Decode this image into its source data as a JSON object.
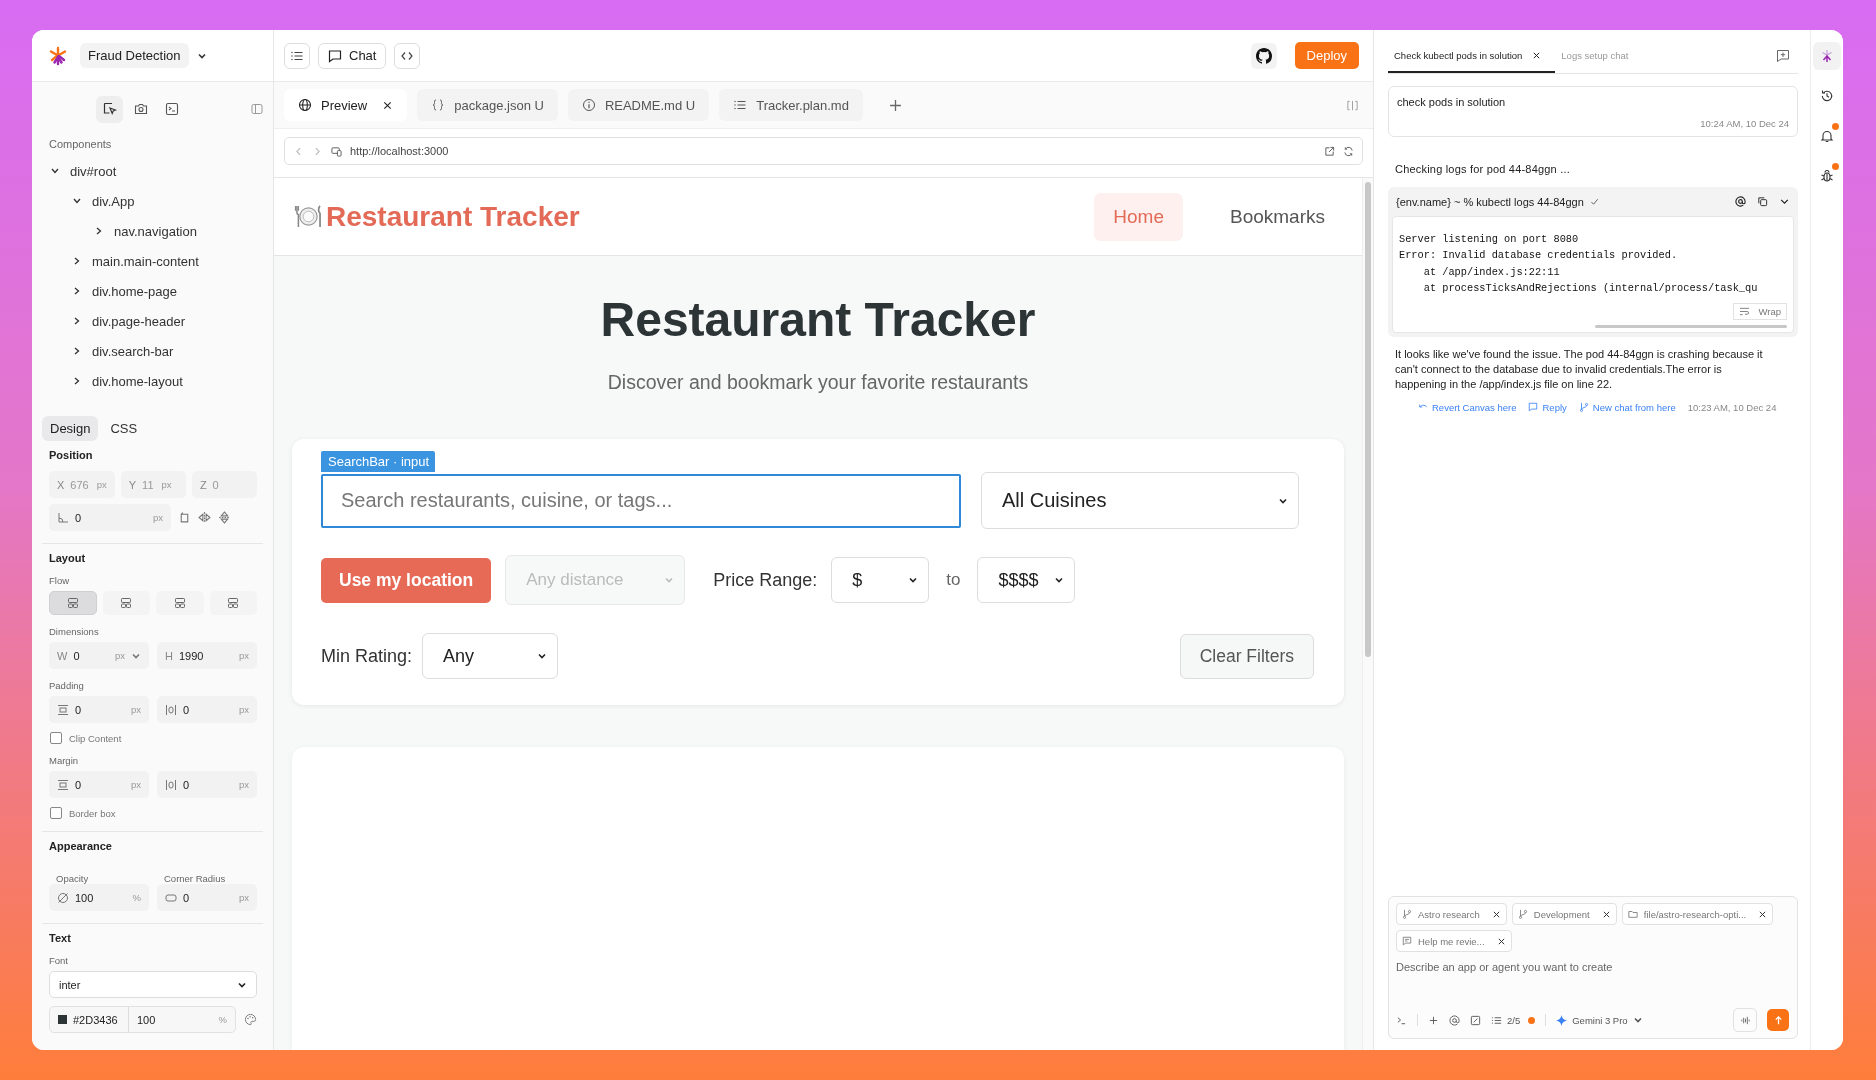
{
  "project": {
    "name": "Fraud Detection"
  },
  "components": {
    "title": "Components",
    "tree": [
      {
        "label": "div#root",
        "expanded": true,
        "children": [
          {
            "label": "div.App",
            "expanded": true,
            "children": [
              {
                "label": "nav.navigation",
                "expanded": false
              }
            ]
          },
          {
            "label": "main.main-content",
            "expanded": false
          },
          {
            "label": "div.home-page",
            "expanded": false
          },
          {
            "label": "div.page-header",
            "expanded": false
          },
          {
            "label": "div.search-bar",
            "expanded": false
          },
          {
            "label": "div.home-layout",
            "expanded": false
          }
        ]
      }
    ]
  },
  "inspector_tabs": [
    {
      "label": "Design",
      "selected": true
    },
    {
      "label": "CSS",
      "selected": false
    }
  ],
  "position": {
    "title": "Position",
    "fields": [
      {
        "prefix": "X",
        "value": "676",
        "unit": "px"
      },
      {
        "prefix": "Y",
        "value": "11",
        "unit": "px"
      },
      {
        "prefix": "Z",
        "value": "0"
      }
    ],
    "rotation": {
      "value": "0",
      "unit": "px"
    }
  },
  "layout": {
    "title": "Layout",
    "flow_label": "Flow",
    "flow_options": [
      {
        "selected": true
      },
      {
        "selected": false
      },
      {
        "selected": false
      },
      {
        "selected": false
      }
    ]
  },
  "dimensions": {
    "label": "Dimensions",
    "width": {
      "prefix": "W",
      "value": "0",
      "unit": "px"
    },
    "height": {
      "prefix": "H",
      "value": "1990",
      "unit": "px"
    }
  },
  "padding": {
    "label": "Padding",
    "vertical": {
      "value": "0",
      "unit": "px"
    },
    "horizontal": {
      "value": "0",
      "unit": "px"
    },
    "option": {
      "label": "Clip Content",
      "checked": false
    }
  },
  "margin": {
    "label": "Margin",
    "vertical": {
      "value": "0",
      "unit": "px"
    },
    "horizontal": {
      "value": "0",
      "unit": "px"
    },
    "option": {
      "label": "Border box",
      "checked": false
    }
  },
  "appearance": {
    "title": "Appearance",
    "opacity": {
      "label": "Opacity",
      "value": "100",
      "unit": "%"
    },
    "corner_radius": {
      "label": "Corner Radius",
      "value": "0",
      "unit": "px"
    }
  },
  "text": {
    "title": "Text",
    "font_label": "Font",
    "font": "inter",
    "color": "#2D3436",
    "color_opacity": "100",
    "opacity_unit": "%"
  },
  "toolbar": {
    "chat_label": "Chat",
    "deploy_label": "Deploy"
  },
  "editor_tabs": [
    {
      "label": "Preview",
      "kind": "preview",
      "selected": true,
      "closable": true
    },
    {
      "label": "package.json U",
      "kind": "json",
      "selected": false,
      "closable": false
    },
    {
      "label": "README.md U",
      "kind": "info",
      "selected": false,
      "closable": false
    },
    {
      "label": "Tracker.plan.md",
      "kind": "list",
      "selected": false,
      "closable": false
    }
  ],
  "browser": {
    "url": "http://localhost:3000"
  },
  "preview": {
    "brand": "Restaurant Tracker",
    "nav": [
      {
        "label": "Home",
        "selected": true
      },
      {
        "label": "Bookmarks",
        "selected": false
      }
    ],
    "heading": "Restaurant Tracker",
    "subtitle": "Discover and bookmark your favorite restaurants",
    "inspector_tag": "SearchBar · input",
    "search_placeholder": "Search restaurants, cuisine, or tags...",
    "cuisine": "All Cuisines",
    "location_button": "Use my location",
    "distance": {
      "value": "Any distance",
      "disabled": true
    },
    "price_label": "Price Range:",
    "price_min": "$",
    "price_to": "to",
    "price_max": "$$$$",
    "rating_label": "Min Rating:",
    "rating": "Any",
    "clear_button": "Clear Filters"
  },
  "chat": {
    "tabs": [
      {
        "label": "Check kubectl pods in solution",
        "selected": true,
        "closable": true
      },
      {
        "label": "Logs setup chat",
        "selected": false,
        "closable": false
      }
    ],
    "messages": [
      {
        "kind": "user",
        "text": "check pods in solution",
        "time": "10:24 AM, 10 Dec 24"
      },
      {
        "kind": "status",
        "text": "Checking logs for pod 44-84ggn ..."
      },
      {
        "kind": "terminal",
        "command": "{env.name} ~ % kubectl logs 44-84ggn",
        "lines": [
          "Server listening on port 8080",
          "Error: Invalid database credentials provided.",
          "    at /app/index.js:22:11",
          "    at processTicksAndRejections (internal/process/task_qu"
        ],
        "wrap_label": "Wrap"
      },
      {
        "kind": "assistant",
        "text": "It looks like we've found the issue. The pod 44-84ggn is crashing because it can't connect to the database due to invalid credentials.The error is happening in the /app/index.js file on line 22.",
        "actions": [
          {
            "kind": "revert",
            "label": "Revert Canvas here"
          },
          {
            "kind": "reply",
            "label": "Reply"
          },
          {
            "kind": "branch",
            "label": "New chat from here"
          }
        ],
        "time": "10:23 AM, 10 Dec 24"
      }
    ]
  },
  "composer": {
    "chips": [
      {
        "kind": "branch",
        "label": "Astro research"
      },
      {
        "kind": "branch",
        "label": "Development"
      },
      {
        "kind": "folder",
        "label": "file/astro-research-opti..."
      },
      {
        "kind": "chat",
        "label": "Help me revie..."
      }
    ],
    "placeholder": "Describe an app or agent you want to create",
    "todo": "2/5",
    "model": "Gemini 3 Pro"
  }
}
